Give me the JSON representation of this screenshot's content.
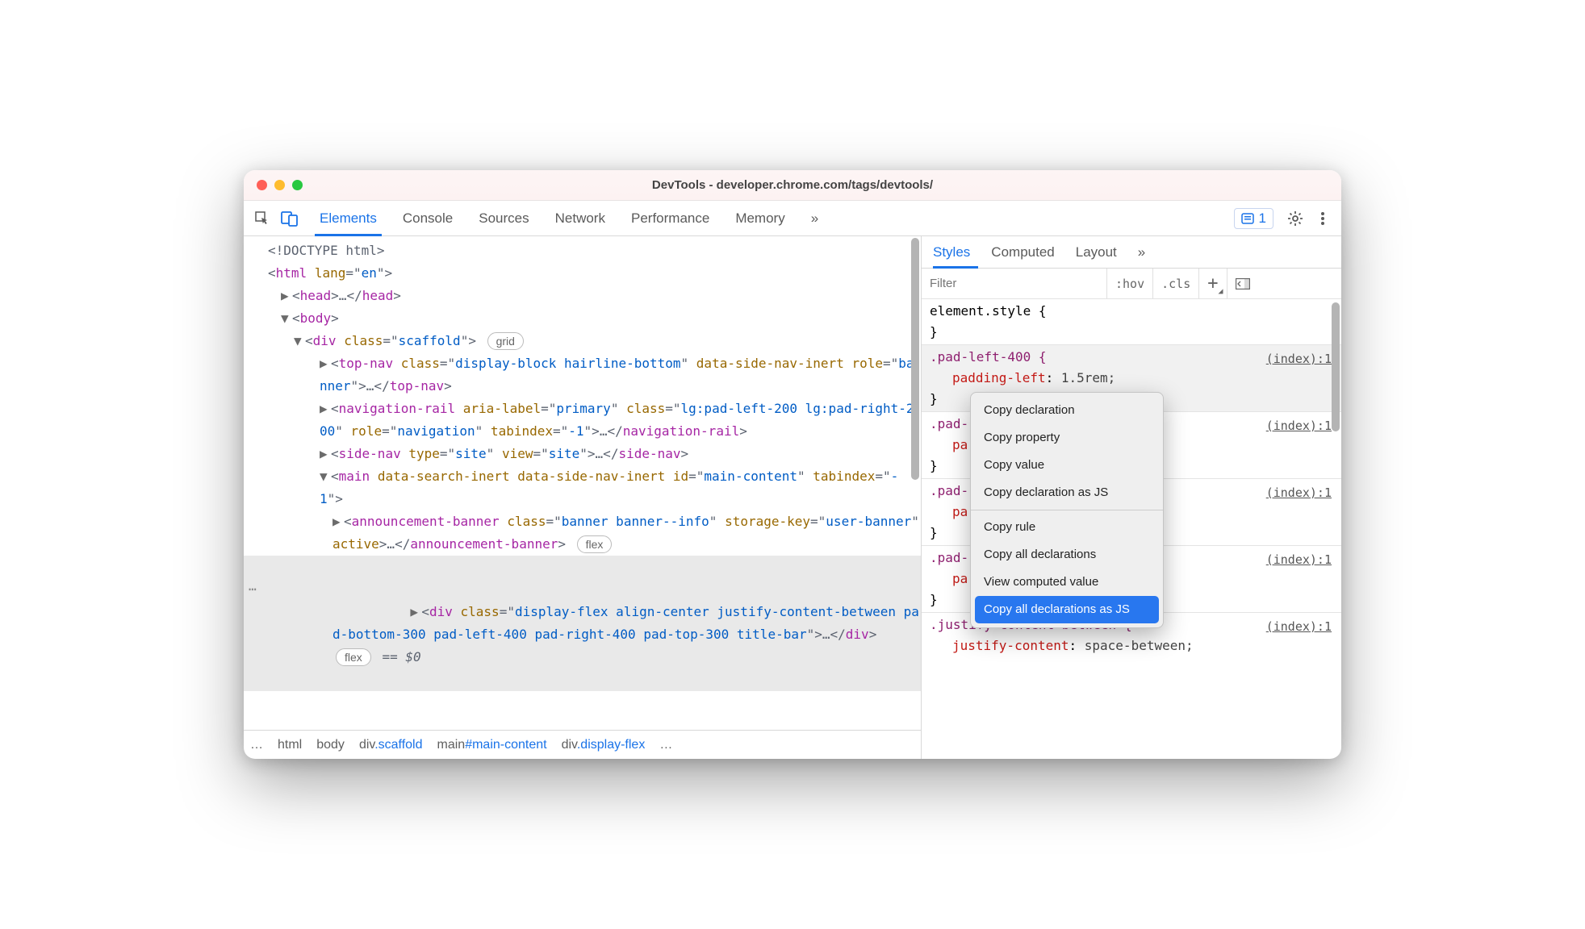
{
  "window": {
    "title": "DevTools - developer.chrome.com/tags/devtools/"
  },
  "tabs": {
    "items": [
      "Elements",
      "Console",
      "Sources",
      "Network",
      "Performance",
      "Memory"
    ],
    "more": "»",
    "issues_count": "1"
  },
  "dom": {
    "doctype": "<!DOCTYPE html>",
    "html_open": "html",
    "html_lang_attr": "lang",
    "html_lang_val": "en",
    "head": "head",
    "body": "body",
    "scaffold_tag": "div",
    "scaffold_attr": "class",
    "scaffold_val": "scaffold",
    "badge_grid": "grid",
    "topnav_tag": "top-nav",
    "topnav_class": "display-block hairline-bottom",
    "topnav_extra": "data-side-nav-inert",
    "topnav_role_attr": "role",
    "topnav_role_val": "banner",
    "navrail_tag": "navigation-rail",
    "navrail_aria_attr": "aria-label",
    "navrail_aria_val": "primary",
    "navrail_class": "lg:pad-left-200 lg:pad-right-200",
    "navrail_role_attr": "role",
    "navrail_role_val": "navigation",
    "navrail_tab_attr": "tabindex",
    "navrail_tab_val": "-1",
    "sidenav_tag": "side-nav",
    "sidenav_type_attr": "type",
    "sidenav_type_val": "site",
    "sidenav_view_attr": "view",
    "sidenav_view_val": "site",
    "main_tag": "main",
    "main_attrs": "data-search-inert data-side-nav-inert",
    "main_id_attr": "id",
    "main_id_val": "main-content",
    "main_tab_attr": "tabindex",
    "main_tab_val": "-1",
    "banner_tag": "announcement-banner",
    "banner_class": "banner banner--info",
    "banner_sk_attr": "storage-key",
    "banner_sk_val": "user-banner",
    "banner_active": "active",
    "badge_flex": "flex",
    "hl_div_tag": "div",
    "hl_div_class": "display-flex align-center justify-content-between pad-bottom-300 pad-left-400 pad-right-400 pad-top-300 title-bar",
    "hl_suffix": "== $0"
  },
  "crumbs": [
    "html",
    "body",
    "div.scaffold",
    "main#main-content",
    "div.display-flex"
  ],
  "rtabs": [
    "Styles",
    "Computed",
    "Layout"
  ],
  "rtabs_more": "»",
  "filter": {
    "placeholder": "Filter",
    "hov": ":hov",
    "cls": ".cls"
  },
  "styles": {
    "element_style": "element.style {",
    "close": "}",
    "rules": [
      {
        "sel": ".pad-left-400 {",
        "prop": "padding-left",
        "val": "1.5rem;",
        "src": "(index):1"
      },
      {
        "sel": ".pad-",
        "prop": "pa",
        "val": "",
        "src": "(index):1"
      },
      {
        "sel": ".pad-",
        "prop": "pa",
        "val": "",
        "src": "(index):1"
      },
      {
        "sel": ".pad-",
        "prop": "pa",
        "val": "",
        "src": "(index):1"
      },
      {
        "sel": ".justify-content-between {",
        "prop": "justify-content",
        "val": "space-between;",
        "src": "(index):1"
      }
    ]
  },
  "ctx": {
    "items": [
      "Copy declaration",
      "Copy property",
      "Copy value",
      "Copy declaration as JS",
      "Copy rule",
      "Copy all declarations",
      "View computed value",
      "Copy all declarations as JS"
    ]
  }
}
